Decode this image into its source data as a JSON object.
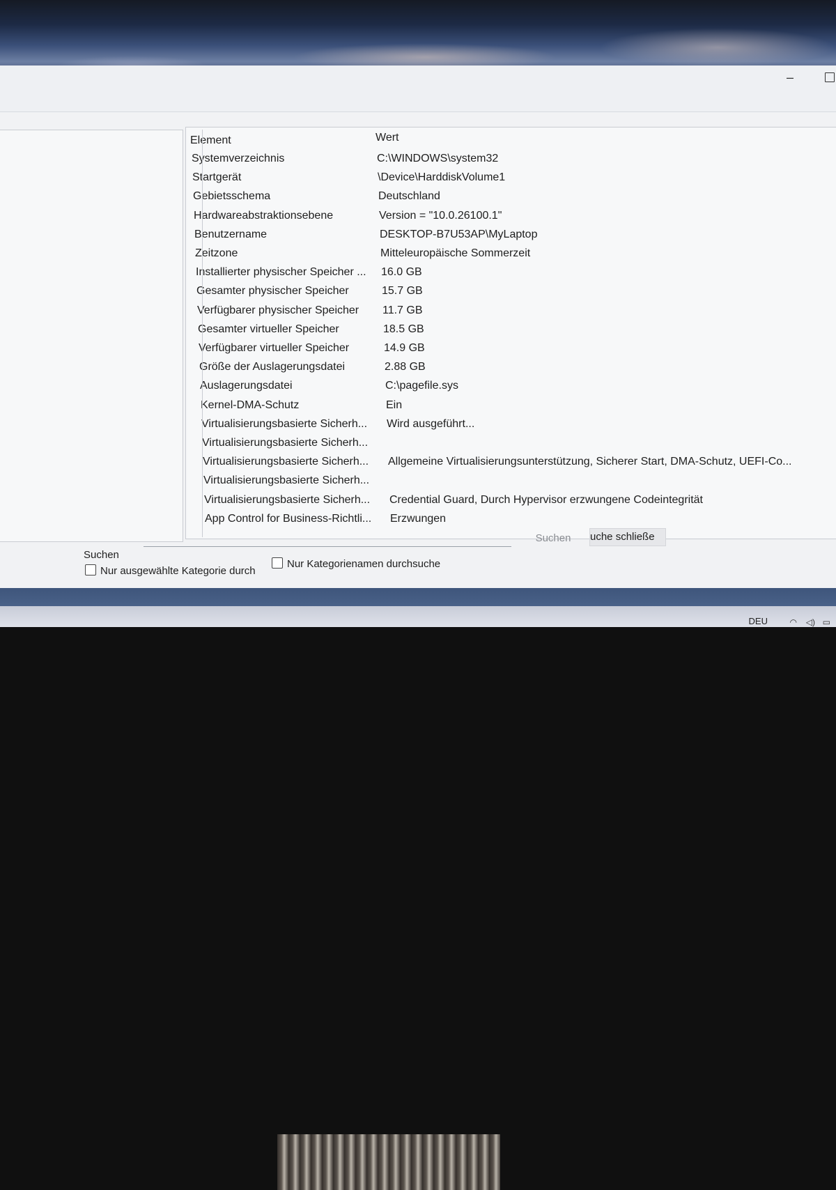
{
  "table": {
    "header": {
      "element": "Element",
      "value": "Wert"
    },
    "rows": [
      {
        "element": "Systemverzeichnis",
        "value": "C:\\WINDOWS\\system32"
      },
      {
        "element": "Startgerät",
        "value": "\\Device\\HarddiskVolume1"
      },
      {
        "element": "Gebietsschema",
        "value": "Deutschland"
      },
      {
        "element": "Hardwareabstraktionsebene",
        "value": "Version = \"10.0.26100.1\""
      },
      {
        "element": "Benutzername",
        "value": "DESKTOP-B7U53AP\\MyLaptop"
      },
      {
        "element": "Zeitzone",
        "value": "Mitteleuropäische Sommerzeit"
      },
      {
        "element": "Installierter physischer Speicher ...",
        "value": "16.0 GB"
      },
      {
        "element": "Gesamter physischer Speicher",
        "value": "15.7 GB"
      },
      {
        "element": "Verfügbarer physischer Speicher",
        "value": "11.7 GB"
      },
      {
        "element": "Gesamter virtueller Speicher",
        "value": "18.5 GB"
      },
      {
        "element": "Verfügbarer virtueller Speicher",
        "value": "14.9 GB"
      },
      {
        "element": "Größe der Auslagerungsdatei",
        "value": "2.88 GB"
      },
      {
        "element": "Auslagerungsdatei",
        "value": "C:\\pagefile.sys"
      },
      {
        "element": "Kernel-DMA-Schutz",
        "value": "Ein"
      },
      {
        "element": "Virtualisierungsbasierte Sicherh...",
        "value": "Wird ausgeführt..."
      },
      {
        "element": "Virtualisierungsbasierte Sicherh...",
        "value": ""
      },
      {
        "element": "Virtualisierungsbasierte Sicherh...",
        "value": "Allgemeine Virtualisierungsunterstützung, Sicherer Start, DMA-Schutz, UEFI-Co..."
      },
      {
        "element": "Virtualisierungsbasierte Sicherh...",
        "value": ""
      },
      {
        "element": "Virtualisierungsbasierte Sicherh...",
        "value": "Credential Guard, Durch Hypervisor erzwungene Codeintegrität"
      },
      {
        "element": "App Control for Business-Richtli...",
        "value": "Erzwungen"
      }
    ]
  },
  "search": {
    "label": "Suchen",
    "value": "",
    "search_button": "Suchen",
    "close_button": "uche schließe"
  },
  "options": {
    "selected_category_only": "Nur ausgewählte Kategorie durch",
    "category_names_only": "Nur Kategorienamen durchsuche"
  },
  "taskbar": {
    "language": "DEU"
  }
}
